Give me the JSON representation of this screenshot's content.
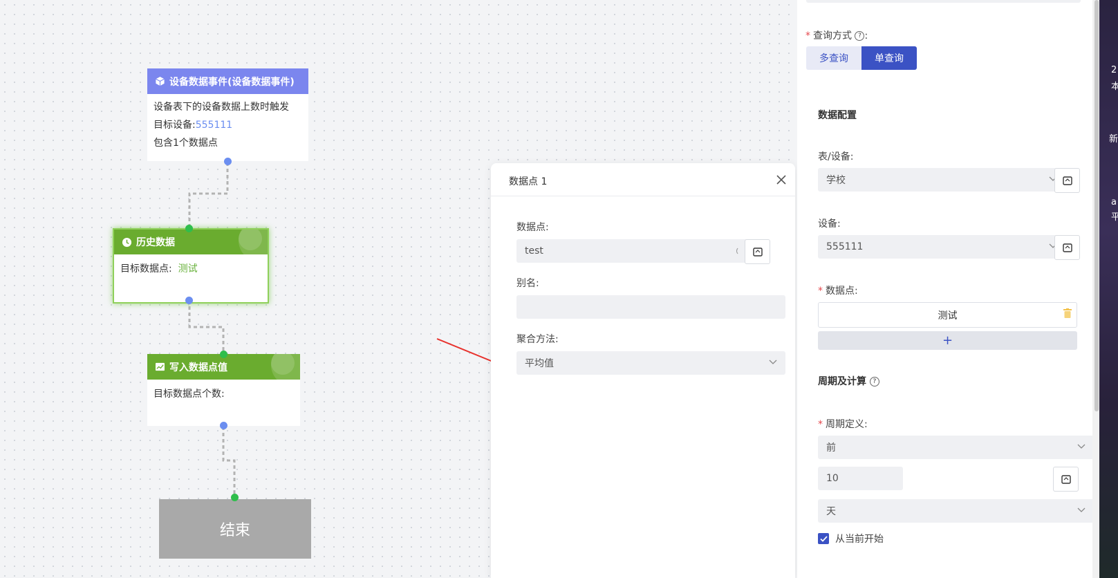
{
  "canvas": {
    "node_event": {
      "title": "设备数据事件(设备数据事件)",
      "icon": "cube-icon",
      "desc": "设备表下的设备数据上数时触发",
      "target_label": "目标设备:",
      "target_value": "555111",
      "count_text": "包含1个数据点",
      "color": "#7b86ee"
    },
    "node_history": {
      "title": "历史数据",
      "icon": "clock-icon",
      "target_label": "目标数据点:",
      "target_value": "测试",
      "color": "#6aac2f"
    },
    "node_write": {
      "title": "写入数据点值",
      "icon": "chart-icon",
      "target_label": "目标数据点个数:",
      "color": "#6aac2f"
    },
    "node_end": {
      "title": "结束",
      "color": "#a9a9a9"
    }
  },
  "modal": {
    "title": "数据点 1",
    "datapoint_label": "数据点:",
    "datapoint_value": "test",
    "alias_label": "别名:",
    "alias_value": "",
    "aggregate_label": "聚合方法:",
    "aggregate_value": "平均值",
    "annotation_color": "#e8322d"
  },
  "panel": {
    "query_mode_label": "查询方式",
    "query_modes": [
      "多查询",
      "单查询"
    ],
    "query_mode_selected": "单查询",
    "data_config_title": "数据配置",
    "table_device_label": "表/设备:",
    "table_device_value": "学校",
    "device_label": "设备:",
    "device_value": "555111",
    "datapoint_label": "数据点:",
    "datapoint_item": "测试",
    "add_symbol": "+",
    "period_title": "周期及计算",
    "period_def_label": "周期定义:",
    "period_direction": "前",
    "period_number": "10",
    "period_unit": "天",
    "from_now_label": "从当前开始",
    "from_now_checked": true,
    "accent_color": "#3b52c4"
  },
  "edge_strip": {
    "texts": [
      "2",
      "本",
      "新",
      "a",
      "平"
    ]
  }
}
